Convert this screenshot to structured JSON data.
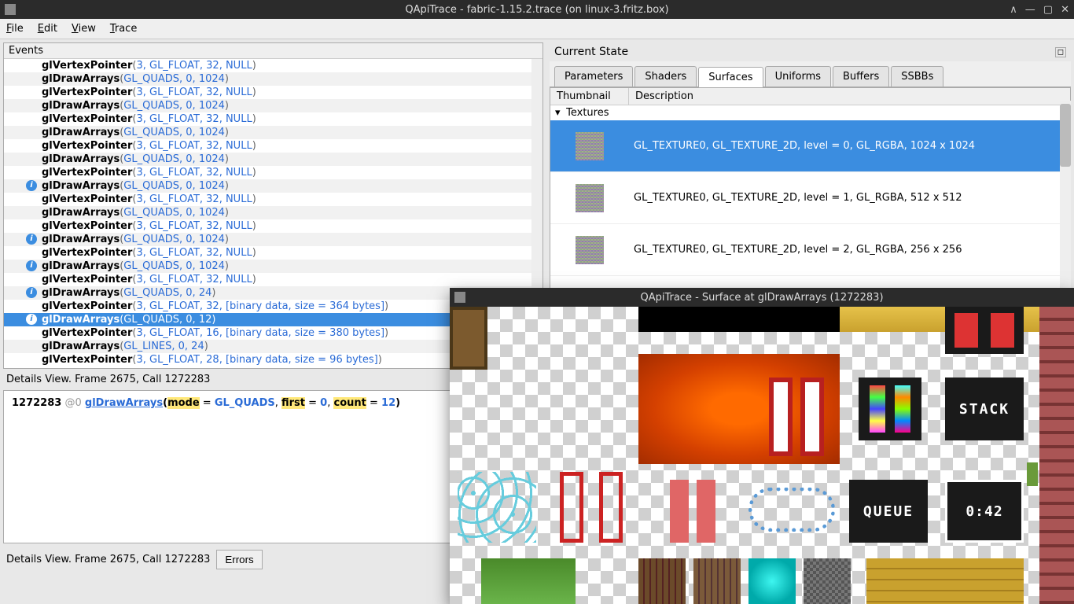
{
  "window": {
    "title": "QApiTrace - fabric-1.15.2.trace (on linux-3.fritz.box)"
  },
  "menubar": {
    "file": "File",
    "edit": "Edit",
    "view": "View",
    "trace": "Trace"
  },
  "events": {
    "header": "Events",
    "rows": [
      {
        "fn": "glVertexPointer",
        "args": "3, GL_FLOAT, 32, NULL",
        "info": false,
        "sel": false
      },
      {
        "fn": "glDrawArrays",
        "args": "GL_QUADS, 0, 1024",
        "info": false,
        "sel": false
      },
      {
        "fn": "glVertexPointer",
        "args": "3, GL_FLOAT, 32, NULL",
        "info": false,
        "sel": false
      },
      {
        "fn": "glDrawArrays",
        "args": "GL_QUADS, 0, 1024",
        "info": false,
        "sel": false
      },
      {
        "fn": "glVertexPointer",
        "args": "3, GL_FLOAT, 32, NULL",
        "info": false,
        "sel": false
      },
      {
        "fn": "glDrawArrays",
        "args": "GL_QUADS, 0, 1024",
        "info": false,
        "sel": false
      },
      {
        "fn": "glVertexPointer",
        "args": "3, GL_FLOAT, 32, NULL",
        "info": false,
        "sel": false
      },
      {
        "fn": "glDrawArrays",
        "args": "GL_QUADS, 0, 1024",
        "info": false,
        "sel": false
      },
      {
        "fn": "glVertexPointer",
        "args": "3, GL_FLOAT, 32, NULL",
        "info": false,
        "sel": false
      },
      {
        "fn": "glDrawArrays",
        "args": "GL_QUADS, 0, 1024",
        "info": true,
        "sel": false
      },
      {
        "fn": "glVertexPointer",
        "args": "3, GL_FLOAT, 32, NULL",
        "info": false,
        "sel": false
      },
      {
        "fn": "glDrawArrays",
        "args": "GL_QUADS, 0, 1024",
        "info": false,
        "sel": false
      },
      {
        "fn": "glVertexPointer",
        "args": "3, GL_FLOAT, 32, NULL",
        "info": false,
        "sel": false
      },
      {
        "fn": "glDrawArrays",
        "args": "GL_QUADS, 0, 1024",
        "info": true,
        "sel": false
      },
      {
        "fn": "glVertexPointer",
        "args": "3, GL_FLOAT, 32, NULL",
        "info": false,
        "sel": false
      },
      {
        "fn": "glDrawArrays",
        "args": "GL_QUADS, 0, 1024",
        "info": true,
        "sel": false
      },
      {
        "fn": "glVertexPointer",
        "args": "3, GL_FLOAT, 32, NULL",
        "info": false,
        "sel": false
      },
      {
        "fn": "glDrawArrays",
        "args": "GL_QUADS, 0, 24",
        "info": true,
        "sel": false
      },
      {
        "fn": "glVertexPointer",
        "args": "3, GL_FLOAT, 32, [binary data, size = 364 bytes]",
        "info": false,
        "sel": false
      },
      {
        "fn": "glDrawArrays",
        "args": "GL_QUADS, 0, 12",
        "info": true,
        "sel": true
      },
      {
        "fn": "glVertexPointer",
        "args": "3, GL_FLOAT, 16, [binary data, size = 380 bytes]",
        "info": false,
        "sel": false
      },
      {
        "fn": "glDrawArrays",
        "args": "GL_LINES, 0, 24",
        "info": false,
        "sel": false
      },
      {
        "fn": "glVertexPointer",
        "args": "3, GL_FLOAT, 28, [binary data, size = 96 bytes]",
        "info": false,
        "sel": false
      }
    ]
  },
  "details": {
    "label": "Details View. Frame 2675, Call 1272283",
    "callnum": "1272283",
    "at": "@0",
    "fn": "glDrawArrays",
    "p_mode": "mode",
    "v_mode": "GL_QUADS",
    "p_first": "first",
    "v_first": "0",
    "p_count": "count",
    "v_count": "12"
  },
  "bottom": {
    "status": "Details View. Frame 2675, Call 1272283",
    "errors": "Errors"
  },
  "currentState": {
    "title": "Current State",
    "tabs": {
      "parameters": "Parameters",
      "shaders": "Shaders",
      "surfaces": "Surfaces",
      "uniforms": "Uniforms",
      "buffers": "Buffers",
      "ssbbs": "SSBBs"
    },
    "columns": {
      "thumbnail": "Thumbnail",
      "description": "Description"
    },
    "texturesLabel": "Textures",
    "surfaces": [
      {
        "desc": "GL_TEXTURE0, GL_TEXTURE_2D, level = 0, GL_RGBA, 1024 x 1024",
        "sel": true
      },
      {
        "desc": "GL_TEXTURE0, GL_TEXTURE_2D, level = 1, GL_RGBA, 512 x 512",
        "sel": false
      },
      {
        "desc": "GL_TEXTURE0, GL_TEXTURE_2D, level = 2, GL_RGBA, 256 x 256",
        "sel": false
      }
    ]
  },
  "popup": {
    "title": "QApiTrace - Surface at glDrawArrays (1272283)",
    "labels": {
      "stack": "STACK",
      "queue": "QUEUE",
      "timer": "0:42"
    }
  }
}
